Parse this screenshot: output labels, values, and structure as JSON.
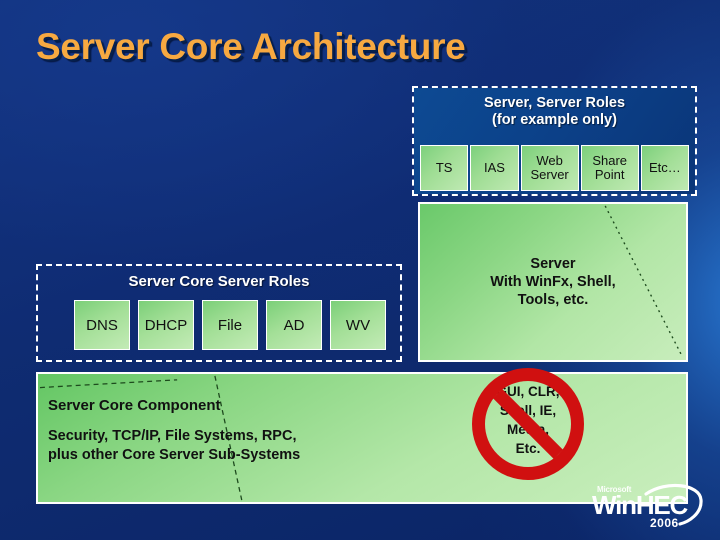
{
  "slide": {
    "title": "Server Core Architecture",
    "background_top": "#13357f",
    "background_bottom": "#0b2566",
    "title_color": "#f7a941"
  },
  "roles_box": {
    "heading": "Server, Server Roles\n(for example only)",
    "heading_line1": "Server, Server Roles",
    "heading_line2": "(for example only)",
    "tiles": [
      {
        "label": "TS"
      },
      {
        "label": "IAS"
      },
      {
        "label": "Web Server"
      },
      {
        "label": "Share Point"
      },
      {
        "label": "Etc…"
      }
    ]
  },
  "core_roles_box": {
    "heading": "Server Core Server Roles",
    "tiles": [
      {
        "label": "DNS"
      },
      {
        "label": "DHCP"
      },
      {
        "label": "File"
      },
      {
        "label": "AD"
      },
      {
        "label": "WV"
      }
    ]
  },
  "server_panel": {
    "label": "Server\nWith WinFx, Shell,\nTools, etc.",
    "fill_color": "#8bd684"
  },
  "core_strip": {
    "title": "Server Core Component",
    "subtitle": "Security, TCP/IP, File Systems, RPC,\nplus other Core Server Sub-Systems",
    "fill_color": "#8ad683"
  },
  "no_entry": {
    "label": "GUI, CLR,\nShell, IE,\nMedia,\nEtc.",
    "color": "#d01010"
  },
  "logo": {
    "microsoft": "Microsoft",
    "name": "WinHEC",
    "year": "2006"
  }
}
